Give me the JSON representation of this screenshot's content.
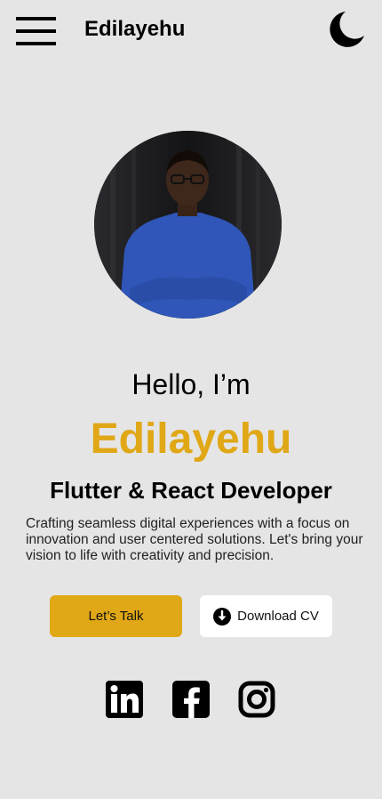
{
  "header": {
    "brand": "Edilayehu",
    "menu_icon": "hamburger-menu-icon",
    "theme_icon": "moon-icon"
  },
  "hero": {
    "greeting": "Hello, I’m",
    "name": "Edilayehu",
    "role": "Flutter & React Developer",
    "description": "Crafting seamless digital experiences with a focus on innovation and user centered solutions. Let's bring your vision to life with creativity and precision."
  },
  "actions": {
    "talk_label": "Let’s Talk",
    "cv_label": "Download CV",
    "cv_icon": "download-circle-icon"
  },
  "social": {
    "icons": [
      "linkedin-icon",
      "facebook-icon",
      "instagram-icon"
    ]
  },
  "colors": {
    "accent": "#e0a716",
    "background": "#e5e5e5",
    "text": "#000000",
    "button_secondary_bg": "#ffffff"
  }
}
